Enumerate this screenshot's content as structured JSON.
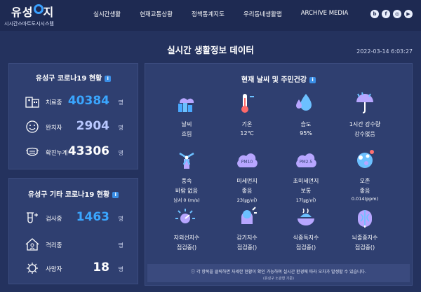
{
  "logo": {
    "main": "유성",
    "main2": "지",
    "sub": "시시간스마트도시시스템"
  },
  "nav": [
    "실시간생활",
    "현재교통상황",
    "정책통계지도",
    "우리동네생활맵",
    "ARCHIVE MEDIA"
  ],
  "social": [
    "b",
    "f",
    "◎",
    "▶"
  ],
  "page_title": "실시간 생활정보 데이터",
  "timestamp": "2022-03-14 6:03:27",
  "covid": {
    "title": "유성구 코로나19 현황",
    "rows": [
      {
        "label": "치료중",
        "value": "40384",
        "unit": "명"
      },
      {
        "label": "완치자",
        "value": "2904",
        "unit": "명"
      },
      {
        "label": "확진누계",
        "value": "43306",
        "unit": "명"
      }
    ]
  },
  "covid_other": {
    "title": "유성구 기타 코로나19 현황",
    "rows": [
      {
        "label": "검사중",
        "value": "1463",
        "unit": "명"
      },
      {
        "label": "격리중",
        "value": "",
        "unit": "명"
      },
      {
        "label": "사망자",
        "value": "18",
        "unit": "명"
      }
    ]
  },
  "weather": {
    "title": "현재 날씨 및 주민건강",
    "cells": [
      {
        "label": "날씨",
        "value": "흐림",
        "sub": "",
        "icon": "cloudy-city-icon"
      },
      {
        "label": "기온",
        "value": "12℃",
        "sub": "",
        "icon": "thermometer-icon"
      },
      {
        "label": "습도",
        "value": "95%",
        "sub": "",
        "icon": "humidity-icon"
      },
      {
        "label": "1시간 강수량",
        "value": "강수없음",
        "sub": "",
        "icon": "umbrella-icon"
      },
      {
        "label": "풍속",
        "value": "바람 없음",
        "sub": "남서 0 (m/s)",
        "icon": "windmill-icon"
      },
      {
        "label": "미세먼지",
        "value": "좋음",
        "sub": "23(㎍/㎥)",
        "icon": "fine-dust-icon"
      },
      {
        "label": "초미세먼지",
        "value": "보통",
        "sub": "17(㎍/㎥)",
        "icon": "ultrafine-dust-icon"
      },
      {
        "label": "오존",
        "value": "좋음",
        "sub": "0.014(ppm)",
        "icon": "ozone-icon"
      },
      {
        "label": "자외선지수",
        "value": "점검중()",
        "sub": "",
        "icon": "uv-icon"
      },
      {
        "label": "감기지수",
        "value": "점검중()",
        "sub": "",
        "icon": "cold-icon"
      },
      {
        "label": "식중독지수",
        "value": "점검중()",
        "sub": "",
        "icon": "food-poison-icon"
      },
      {
        "label": "뇌졸중지수",
        "value": "점검중()",
        "sub": "",
        "icon": "stroke-icon"
      }
    ],
    "notice": "각 항목을 클릭하면 자세한 현황이 확인 가능하며 실시간 환경에 따라 오차가 발생할 수 있습니다.",
    "notice_sub": "(유성구 노관형 기준)"
  },
  "colors": {
    "bg": "#24325e",
    "panel": "#2f3f70",
    "accent_blue": "#3aa6ff",
    "accent_lavender": "#b8c7ff"
  }
}
